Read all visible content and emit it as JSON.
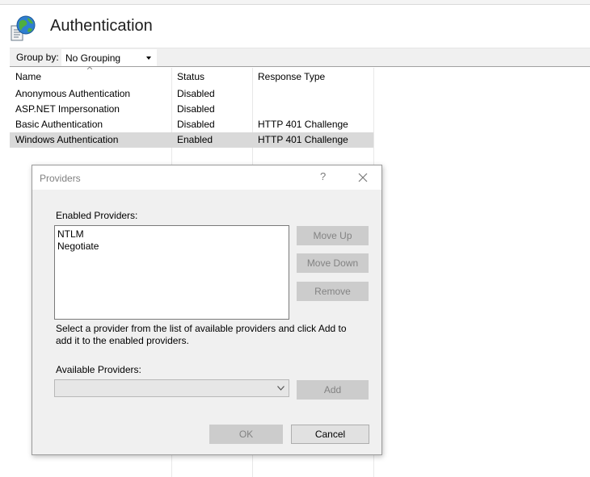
{
  "header": {
    "title": "Authentication",
    "icon": "authentication-globe-document-icon"
  },
  "toolbar": {
    "group_by_label": "Group by:",
    "group_by_value": "No Grouping"
  },
  "grid": {
    "columns": [
      "Name",
      "Status",
      "Response Type"
    ],
    "rows": [
      {
        "name": "Anonymous Authentication",
        "status": "Disabled",
        "response": ""
      },
      {
        "name": "ASP.NET Impersonation",
        "status": "Disabled",
        "response": ""
      },
      {
        "name": "Basic Authentication",
        "status": "Disabled",
        "response": "HTTP 401 Challenge"
      },
      {
        "name": "Windows Authentication",
        "status": "Enabled",
        "response": "HTTP 401 Challenge"
      }
    ],
    "selected_row": 3
  },
  "dialog": {
    "title": "Providers",
    "help_symbol": "?",
    "enabled_providers_label": "Enabled Providers:",
    "enabled_providers": [
      "NTLM",
      "Negotiate"
    ],
    "move_up_label": "Move Up",
    "move_down_label": "Move Down",
    "remove_label": "Remove",
    "description": "Select a provider from the list of available providers and click Add to add it to the enabled providers.",
    "available_providers_label": "Available Providers:",
    "available_value": "",
    "add_label": "Add",
    "ok_label": "OK",
    "cancel_label": "Cancel"
  },
  "colors": {
    "selection": "#d9d9d9",
    "dialog_bg": "#f0f0f0",
    "disabled_button": "#cccccc",
    "disabled_text": "#838383"
  }
}
